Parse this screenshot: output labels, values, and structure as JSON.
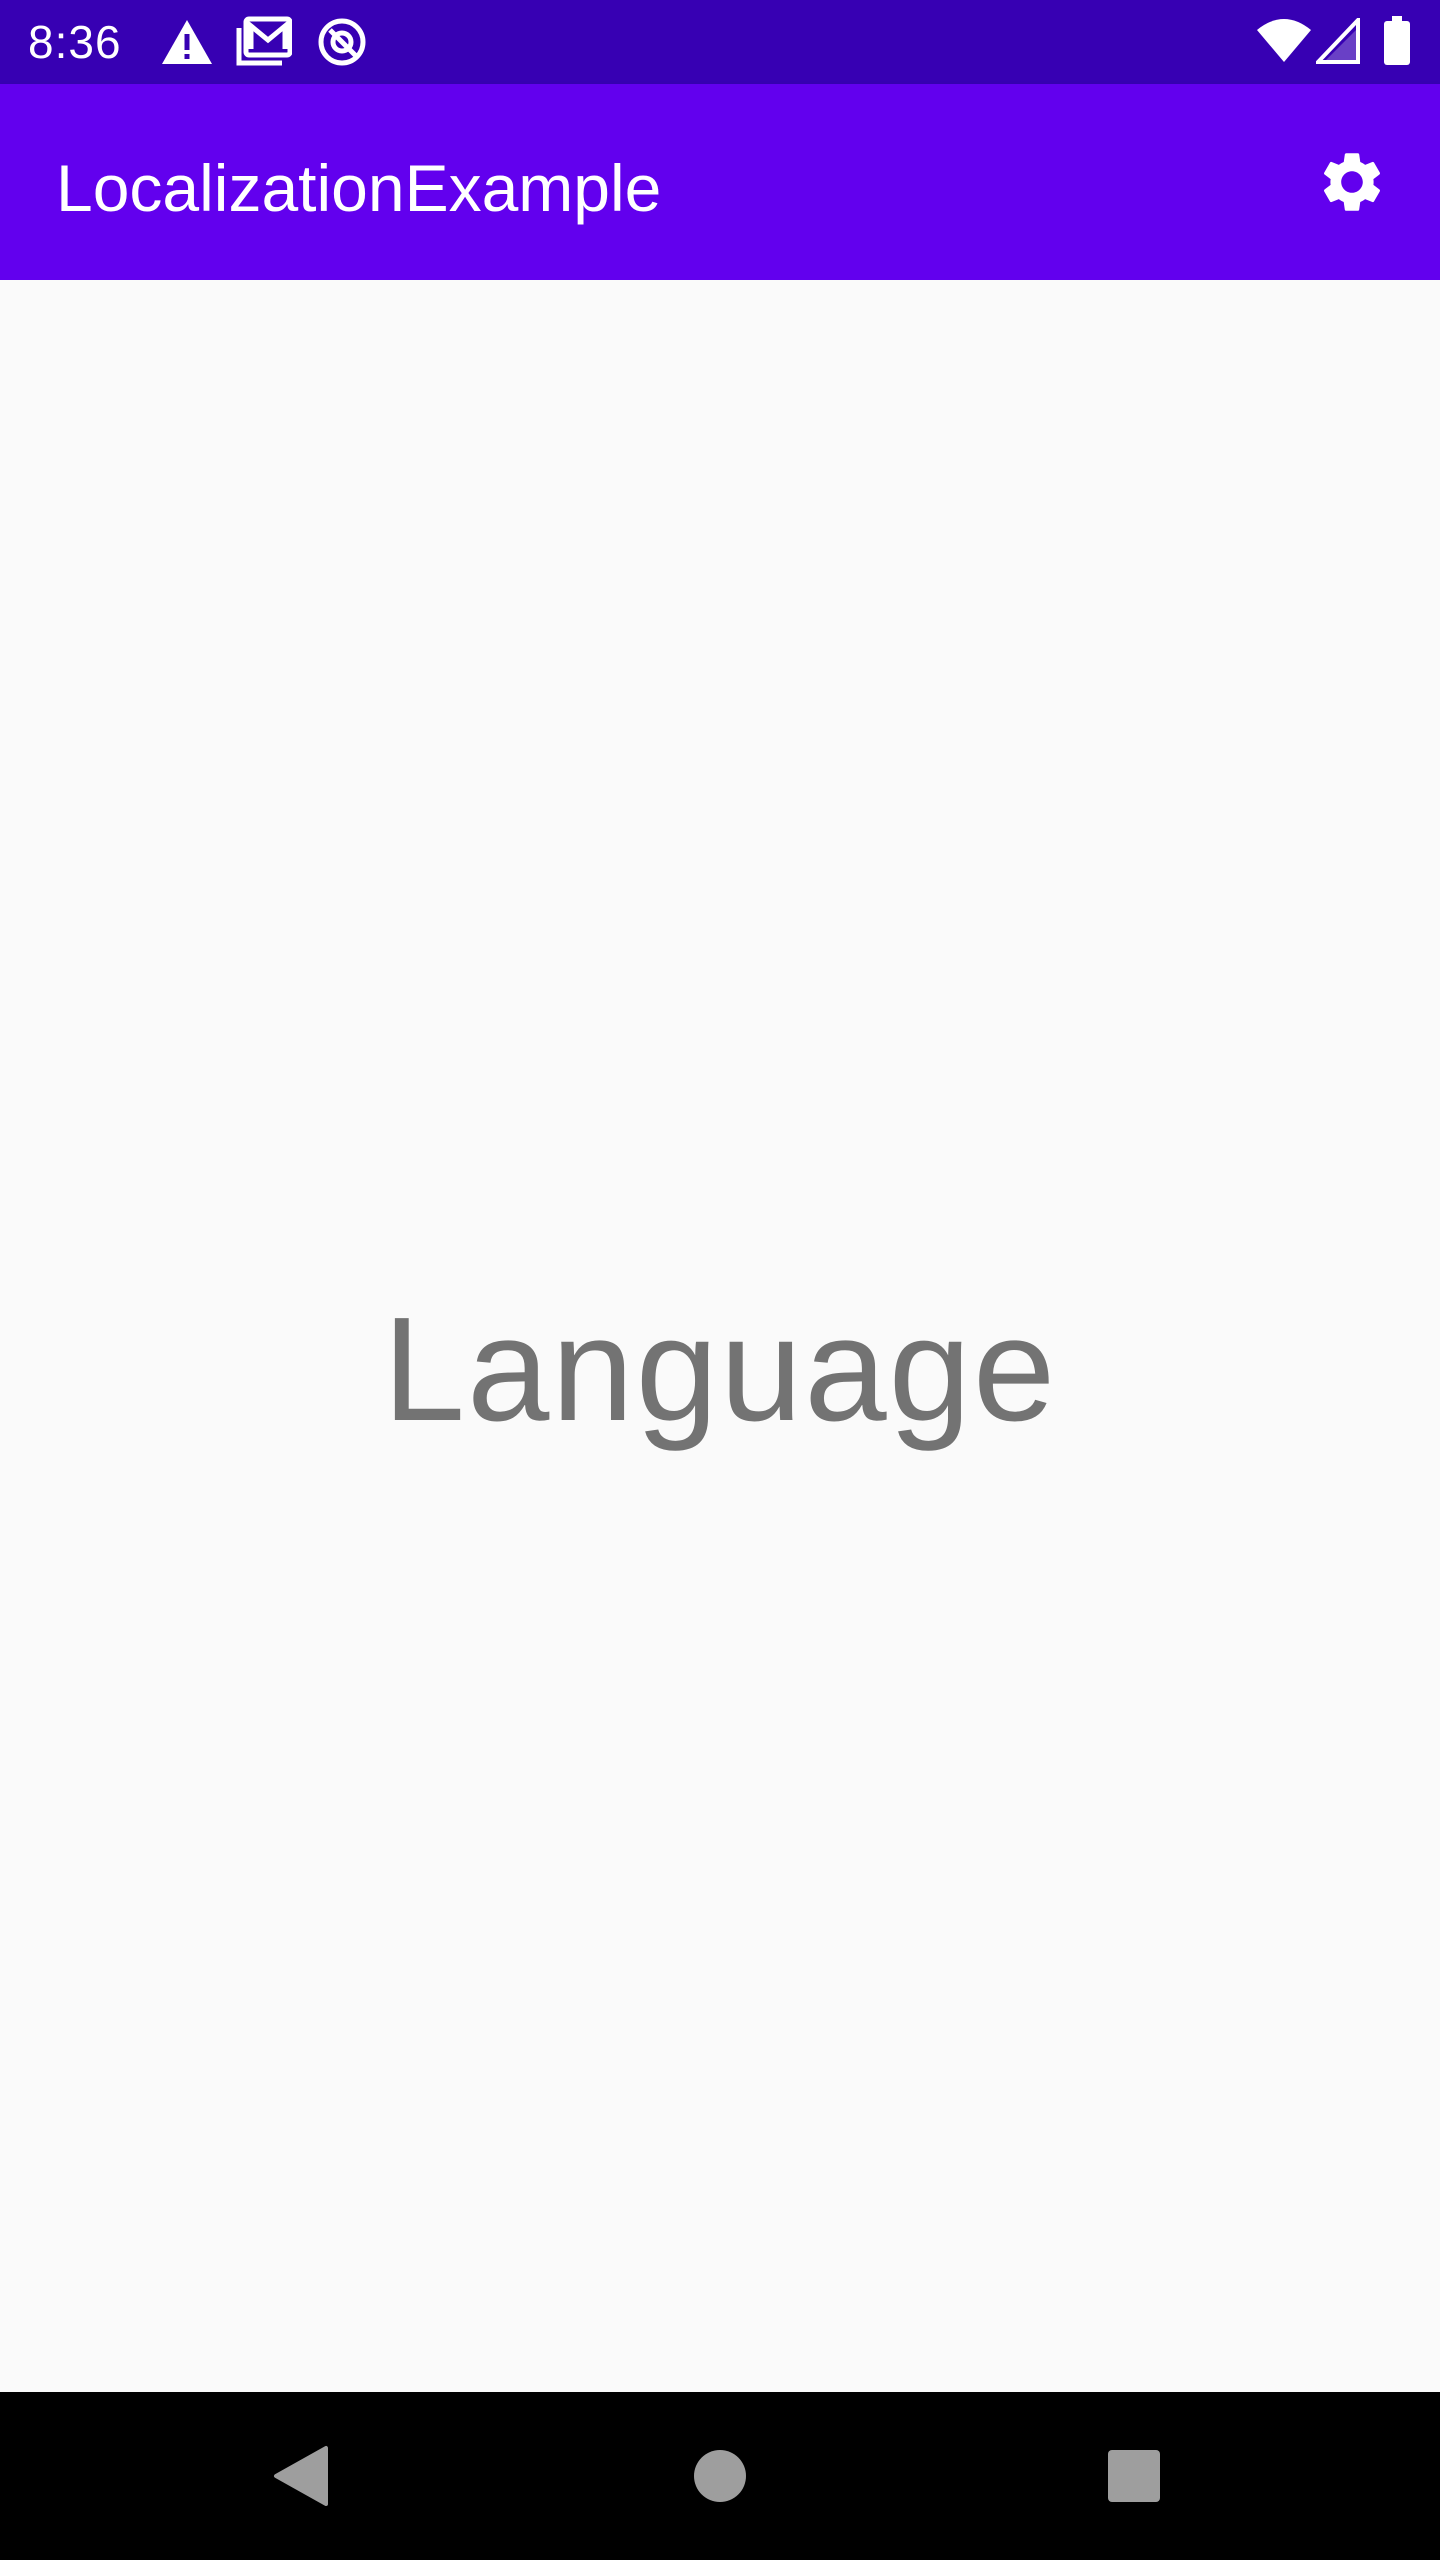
{
  "status_bar": {
    "time": "8:36",
    "left_icons": [
      "alert-icon",
      "gallery-icon",
      "data-saver-icon"
    ],
    "right_icons": [
      "wifi-icon",
      "cell-signal-icon",
      "battery-icon"
    ]
  },
  "app_bar": {
    "title": "LocalizationExample",
    "action_icon": "settings-icon"
  },
  "main": {
    "label": "Language"
  },
  "nav_bar": {
    "buttons": [
      "back-icon",
      "home-icon",
      "recents-icon"
    ]
  },
  "colors": {
    "status_bar": "#3700b3",
    "app_bar": "#6200ee",
    "background": "#fafafa",
    "label_text": "#737373",
    "nav_bar": "#000000",
    "nav_icons": "#9e9e9e"
  }
}
